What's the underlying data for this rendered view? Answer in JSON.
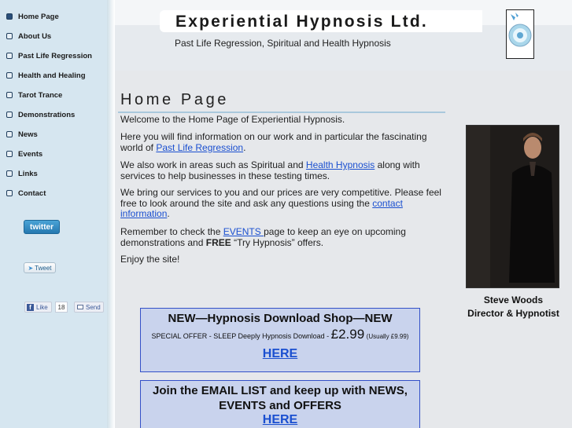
{
  "site": {
    "title": "Experiential Hypnosis Ltd.",
    "subtitle": "Past Life Regression, Spiritual and Health Hypnosis"
  },
  "nav": {
    "items": [
      {
        "label": "Home Page",
        "active": true
      },
      {
        "label": "About Us"
      },
      {
        "label": "Past Life Regression"
      },
      {
        "label": "Health and Healing"
      },
      {
        "label": "Tarot Trance"
      },
      {
        "label": "Demonstrations"
      },
      {
        "label": "News"
      },
      {
        "label": "Events"
      },
      {
        "label": "Links"
      },
      {
        "label": "Contact"
      }
    ]
  },
  "social": {
    "twitter_label": "twitter",
    "tweet_label": "Tweet",
    "like_label": "Like",
    "like_count": "18",
    "send_label": "Send"
  },
  "main": {
    "heading": "Home Page",
    "p1": "Welcome to the Home Page of Experiential Hypnosis.",
    "p2_pre": "Here you will find information on our work and in particular the fascinating world of ",
    "p2_link": "Past Life Regression",
    "p2_post": ".",
    "p3_pre": "We also work in areas such as Spiritual and ",
    "p3_link": "Health Hypnosis",
    "p3_post": " along with services to help businesses in these testing times.",
    "p4_pre": "We bring our services to you and our prices are very competitive. Please feel free to look around the site and ask any questions using the ",
    "p4_link": "contact information",
    "p4_post": ".",
    "p5_pre": "Remember to check the ",
    "p5_link": "EVENTS ",
    "p5_mid": "page to keep an eye on upcoming demonstrations and ",
    "p5_bold": "FREE",
    "p5_post": " “Try Hypnosis” offers.",
    "p6": "Enjoy the site!"
  },
  "portrait": {
    "name": "Steve Woods",
    "role": "Director & Hypnotist"
  },
  "promo1": {
    "title": "NEW—Hypnosis Download Shop—NEW",
    "offer_pre": "SPECIAL OFFER  -  SLEEP Deeply Hypnosis Download - ",
    "price": "£2.99",
    "usually": "(Usually £9.99)",
    "link": "HERE"
  },
  "promo2": {
    "title": "Join the EMAIL LIST and keep up with NEWS, EVENTS and OFFERS",
    "link": "HERE"
  },
  "colors": {
    "sidebar": "#d6e6f0",
    "content_bg": "#e6e8eb",
    "link": "#1a4fd0",
    "promo_bg": "#c9d3ed",
    "promo_border": "#3350c8"
  }
}
